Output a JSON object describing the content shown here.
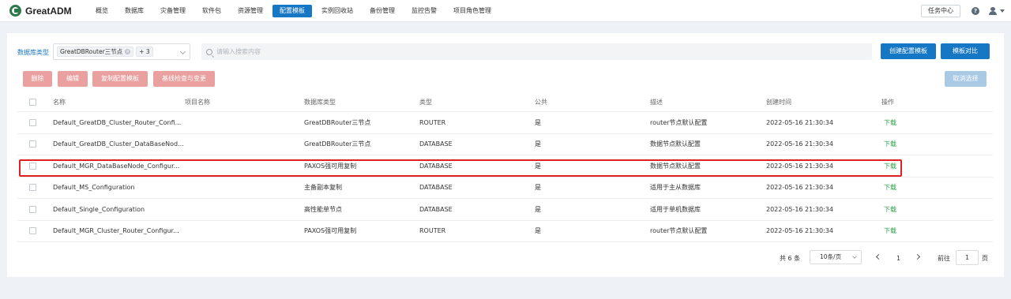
{
  "app": {
    "logo_text": "GreatADM"
  },
  "nav": {
    "items": [
      "概览",
      "数据库",
      "灾备管理",
      "软件包",
      "资源管理",
      "配置模板",
      "实例回收站",
      "备份管理",
      "监控告警",
      "项目角色管理"
    ],
    "active_index": 5
  },
  "top_right": {
    "task_center": "任务中心",
    "help_icon": "?"
  },
  "filter": {
    "label": "数据库类型",
    "selected_tag": "GreatDBRouter三节点",
    "more_tag": "+ 3",
    "search_placeholder": "请输入搜索内容"
  },
  "actions": {
    "create": "创建配置模板",
    "compare": "模板对比",
    "delete": "删除",
    "edit": "编辑",
    "copy": "复制配置模板",
    "baseline": "基线检查与变更",
    "cancel_select": "取消选择"
  },
  "table": {
    "columns": [
      "名称",
      "项目名称",
      "数据库类型",
      "类型",
      "公共",
      "描述",
      "创建时间",
      "操作"
    ],
    "rows": [
      {
        "name": "Default_GreatDB_Cluster_Router_Confi...",
        "project": "",
        "db_type": "GreatDBRouter三节点",
        "type": "ROUTER",
        "public": "是",
        "desc": "router节点默认配置",
        "created": "2022-05-16 21:30:34",
        "op": "下载"
      },
      {
        "name": "Default_GreatDB_Cluster_DataBaseNod...",
        "project": "",
        "db_type": "GreatDBRouter三节点",
        "type": "DATABASE",
        "public": "是",
        "desc": "数据节点默认配置",
        "created": "2022-05-16 21:30:34",
        "op": "下载"
      },
      {
        "name": "Default_MGR_DataBaseNode_Configur...",
        "project": "",
        "db_type": "PAXOS强可用复制",
        "type": "DATABASE",
        "public": "是",
        "desc": "数据节点默认配置",
        "created": "2022-05-16 21:30:34",
        "op": "下载"
      },
      {
        "name": "Default_MS_Configuration",
        "project": "",
        "db_type": "主备副本复制",
        "type": "DATABASE",
        "public": "是",
        "desc": "适用于主从数据库",
        "created": "2022-05-16 21:30:34",
        "op": "下载"
      },
      {
        "name": "Default_Single_Configuration",
        "project": "",
        "db_type": "高性能单节点",
        "type": "DATABASE",
        "public": "是",
        "desc": "适用于单机数据库",
        "created": "2022-05-16 21:30:34",
        "op": "下载"
      },
      {
        "name": "Default_MGR_Cluster_Router_Configur...",
        "project": "",
        "db_type": "PAXOS强可用复制",
        "type": "ROUTER",
        "public": "是",
        "desc": "router节点默认配置",
        "created": "2022-05-16 21:30:34",
        "op": "下载"
      }
    ]
  },
  "pagination": {
    "total_text": "共 6 条",
    "page_size": "10条/页",
    "current_page": "1",
    "goto_label": "前往",
    "goto_value": "1",
    "page_suffix": "页"
  },
  "colors": {
    "accent": "#1677c4",
    "danger_disabled": "#eba0a0",
    "download": "#2aa045",
    "highlight": "#e02020"
  }
}
